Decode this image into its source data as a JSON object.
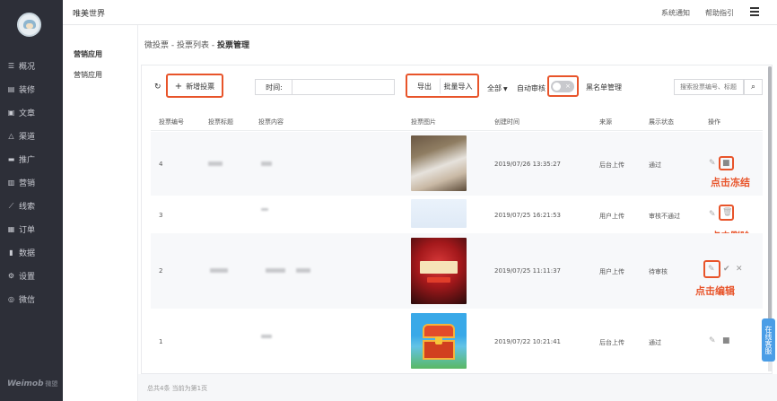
{
  "app": {
    "brand": "唯美世界",
    "header_links": [
      "系统通知",
      "帮助指引"
    ],
    "logo": "Weimob",
    "logo_sub": "微盟"
  },
  "nav": [
    {
      "label": "概况",
      "icon": "list-icon"
    },
    {
      "label": "装修",
      "icon": "brush-icon"
    },
    {
      "label": "文章",
      "icon": "doc-icon"
    },
    {
      "label": "渠道",
      "icon": "triangle-icon"
    },
    {
      "label": "推广",
      "icon": "megaphone-icon"
    },
    {
      "label": "营销",
      "icon": "bar-chart-icon"
    },
    {
      "label": "线索",
      "icon": "trend-icon"
    },
    {
      "label": "订单",
      "icon": "receipt-icon"
    },
    {
      "label": "数据",
      "icon": "stats-icon"
    },
    {
      "label": "设置",
      "icon": "gear-icon"
    },
    {
      "label": "微信",
      "icon": "wechat-icon"
    }
  ],
  "subnav": [
    "营销应用",
    "营销应用"
  ],
  "breadcrumb": {
    "a": "微投票",
    "b": "投票列表",
    "c": "投票管理",
    "sep": " - "
  },
  "toolbar": {
    "add": "新增投票",
    "time_label": "时间:",
    "time_value": "",
    "export": "导出",
    "import": "批量导入",
    "filter": "全部",
    "auto_review": "自动审核",
    "blacklist": "黑名单管理",
    "search_placeholder": "搜索投票编号、标题"
  },
  "table": {
    "headers": [
      "投票编号",
      "投票标题",
      "投票内容",
      "投票图片",
      "创建时间",
      "来源",
      "展示状态",
      "操作"
    ],
    "rows": [
      {
        "id": "4",
        "time": "2019/07/26 13:35:27",
        "source": "后台上传",
        "status": "通过"
      },
      {
        "id": "3",
        "time": "2019/07/25 16:21:53",
        "source": "用户上传",
        "status": "审核不通过"
      },
      {
        "id": "2",
        "time": "2019/07/25 11:11:37",
        "source": "用户上传",
        "status": "待审核"
      },
      {
        "id": "1",
        "time": "2019/07/22 10:21:41",
        "source": "后台上传",
        "status": "通过"
      }
    ]
  },
  "annotations": {
    "freeze": "点击冻结",
    "delete": "点击删除",
    "edit": "点击编辑"
  },
  "pagination": "总共4条 当前为第1页",
  "service": "在线客服",
  "colors": {
    "annotation": "#e8542a",
    "nav_bg": "#2d2f38"
  }
}
